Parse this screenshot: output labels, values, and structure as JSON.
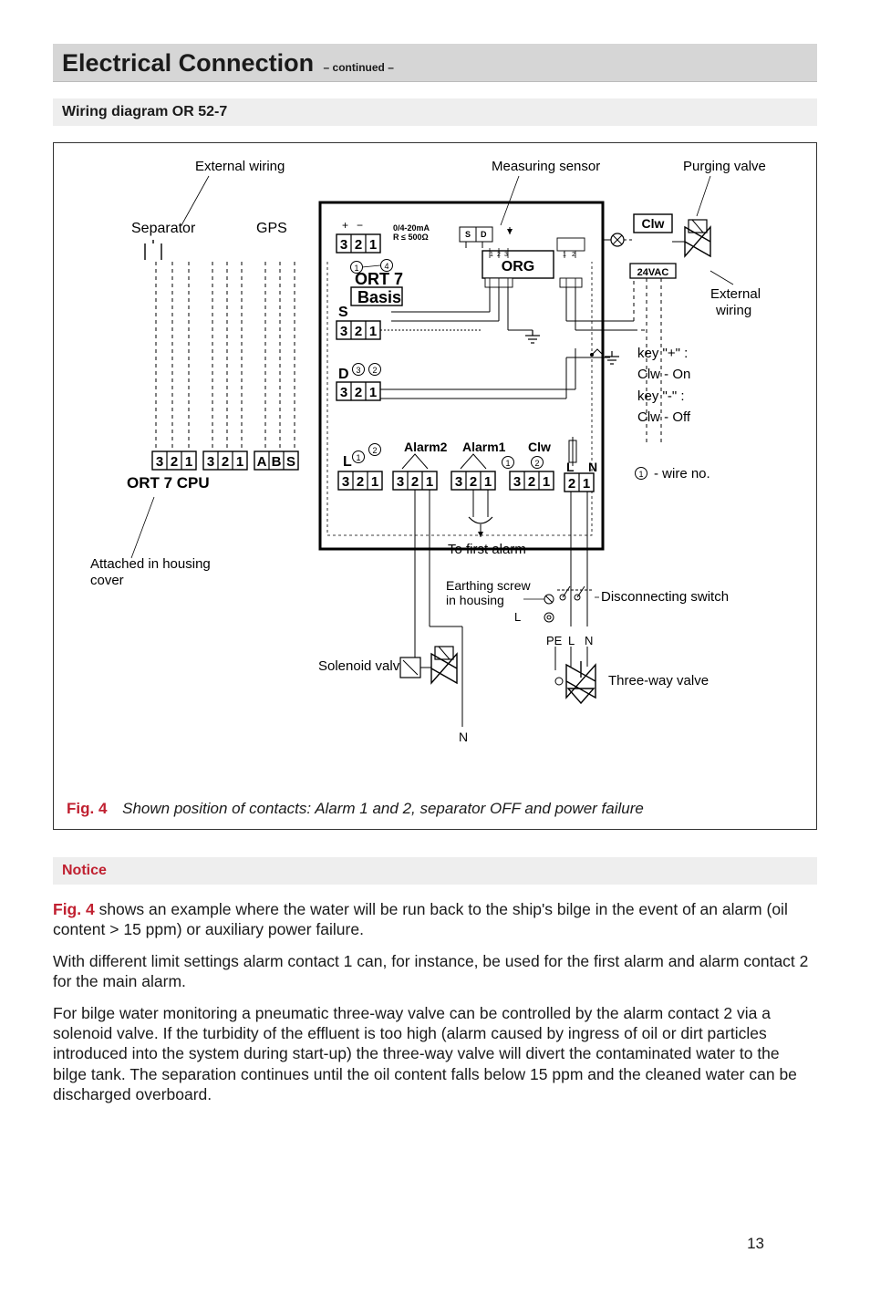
{
  "section": {
    "main": "Electrical Connection",
    "sub": "– continued –"
  },
  "subsection": "Wiring diagram OR 52-7",
  "diagram": {
    "labels": {
      "external_wiring": "External wiring",
      "measuring_sensor": "Measuring sensor",
      "purging_valve": "Purging valve",
      "separator": "Separator",
      "gps": "GPS",
      "clw": "Clw",
      "v24ac": "24VAC",
      "external_wiring2a": "External",
      "external_wiring2b": "wiring",
      "signal1": "0/4-20mA",
      "signal2": "R ≤ 500Ω",
      "ort7": "ORT 7",
      "basis": "Basis",
      "org": "ORG",
      "s": "S",
      "d": "D",
      "l": "L",
      "n": "N",
      "alarm2": "Alarm2",
      "alarm1": "Alarm1",
      "clw2": "Clw",
      "ort7cpu": "ORT 7 CPU",
      "ab": "A",
      "bs": "B",
      "ss": "S",
      "keyplus": "key \"+\" :",
      "clwon": "Clw - On",
      "keyminus": "key \"-\" :",
      "clwoff": "Clw - Off",
      "wireno": "- wire no.",
      "attached1": "Attached in housing",
      "attached2": "cover",
      "tofirst": "To first alarm",
      "earthing1": "Earthing screw",
      "earthing2": "in housing",
      "disconnecting": "Disconnecting switch",
      "solenoid": "Solenoid valve",
      "threeway": "Three-way valve",
      "pe": "PE",
      "l2": "L",
      "n2": "N"
    }
  },
  "figure": {
    "no": "Fig. 4",
    "caption": "Shown position of contacts: Alarm 1 and 2, separator OFF and power failure"
  },
  "notice": {
    "title": "Notice",
    "para1": " shows an example where the water will be run back to the ship's bilge in the event of an alarm (oil content > 15 ppm) or auxiliary power failure.",
    "para1_ref": "Fig. 4",
    "para2": "With different limit settings alarm contact 1 can, for instance, be used for the first alarm and alarm contact 2 for the main alarm.",
    "para3": "For bilge water monitoring a pneumatic three-way valve can be controlled by the alarm contact 2 via a solenoid valve. If the turbidity of the effluent is too high (alarm caused by ingress of oil or dirt particles introduced into the system during start-up) the three-way valve will divert the contaminated water to the bilge tank. The separation continues until the oil content falls below 15 ppm and the cleaned water can be discharged overboard."
  },
  "page": "13",
  "chart_data": {
    "type": "diagram",
    "description": "Wiring diagram OR 52-7 — terminal layout",
    "modules": [
      {
        "name": "ORT 7 CPU",
        "location": "housing cover",
        "terminal_blocks": [
          {
            "label": "",
            "pins": [
              "3",
              "2",
              "1"
            ]
          },
          {
            "label": "",
            "pins": [
              "3",
              "2",
              "1"
            ]
          },
          {
            "label": "",
            "pins": [
              "A",
              "B",
              "S"
            ]
          }
        ]
      },
      {
        "name": "ORT 7 Basis",
        "terminal_blocks": [
          {
            "label": "0/4-20mA R≤500Ω",
            "pins": [
              "3",
              "2",
              "1"
            ],
            "polarity": [
              "+",
              "-"
            ]
          },
          {
            "label": "S",
            "pins": [
              "3",
              "2",
              "1"
            ],
            "wire_nos": [
              1,
              4
            ]
          },
          {
            "label": "D",
            "pins": [
              "3",
              "2",
              "1"
            ],
            "wire_nos": [
              3,
              2
            ]
          },
          {
            "label": "L",
            "pins": [
              "3",
              "2",
              "1"
            ],
            "wire_nos": [
              1,
              2
            ]
          },
          {
            "label": "Alarm2",
            "pins": [
              "3",
              "2",
              "1"
            ]
          },
          {
            "label": "Alarm1",
            "pins": [
              "3",
              "2",
              "1"
            ],
            "wire_nos": [
              1
            ]
          },
          {
            "label": "Clw",
            "pins": [
              "3",
              "2",
              "1"
            ],
            "wire_nos": [
              2
            ]
          },
          {
            "label": "L N",
            "pins": [
              "2",
              "1"
            ]
          }
        ]
      },
      {
        "name": "ORG (Measuring sensor)",
        "connectors": [
          {
            "pins": [
              "S",
              "D"
            ],
            "direction": "in"
          },
          {
            "pins": [
              "1",
              "2",
              "3"
            ],
            "direction": "down"
          },
          {
            "pins": [
              "1",
              "2"
            ],
            "direction": "down"
          }
        ]
      },
      {
        "name": "Clw (24VAC lamp)",
        "supply": "24VAC"
      }
    ],
    "external_connections": [
      "Separator",
      "GPS",
      "External wiring",
      "Solenoid valve (L/N)",
      "Three-way valve (PE/L/N)",
      "Disconnecting switch",
      "Earthing screw in housing",
      "Purging valve"
    ],
    "keys": {
      "+": "Clw - On",
      "-": "Clw - Off",
      "circled_number": "wire no."
    }
  }
}
